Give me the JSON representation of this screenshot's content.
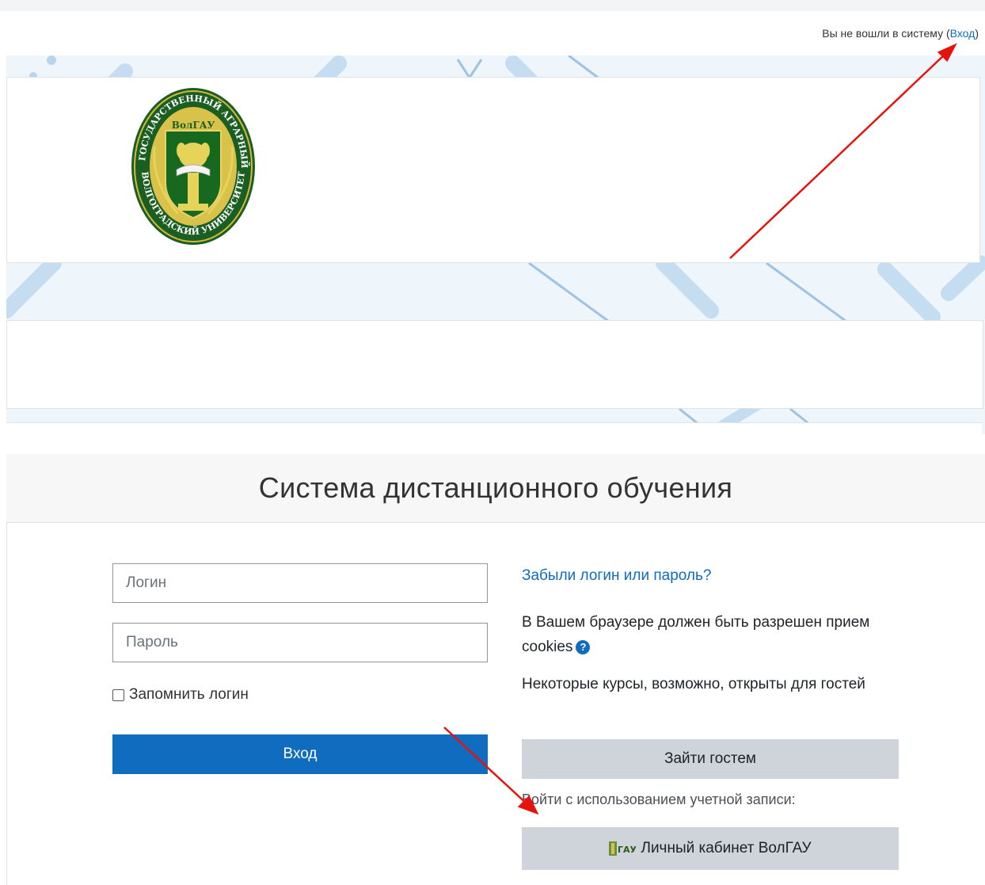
{
  "header": {
    "status_text": "Вы не вошли в систему",
    "login_link": "Вход",
    "logo_ring_text_top": "ГОСУДАРСТВЕННЫЙ АГРАРНЫЙ",
    "logo_ring_text_bottom": "ВОЛГОГРАДСКИЙ УНИВЕРСИТЕТ",
    "logo_abbr": "ВолГАУ"
  },
  "login": {
    "title": "Система дистанционного обучения",
    "username_placeholder": "Логин",
    "password_placeholder": "Пароль",
    "remember_label": "Запомнить логин",
    "login_button": "Вход",
    "forgot_link": "Забыли логин или пароль?",
    "cookies_text": "В Вашем браузере должен быть разрешен прием cookies",
    "guests_text": "Некоторые курсы, возможно, открыты для гостей",
    "guest_button": "Зайти гостем",
    "account_text": "Войти с использованием учетной записи:",
    "sso_button": "Личный кабинет ВолГАУ"
  },
  "colors": {
    "primary": "#0f6cbf",
    "secondary_button": "#ced4da",
    "annotation_arrow": "#e8120c",
    "logo_green": "#1a5e22",
    "logo_gold": "#d4b83a"
  },
  "icons": [
    "help-icon",
    "sso-logo-icon",
    "checkbox-icon"
  ]
}
